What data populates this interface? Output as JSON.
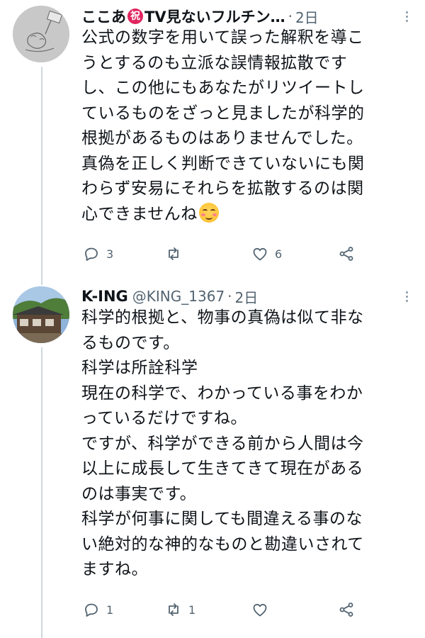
{
  "tweets": [
    {
      "display_name": "ここあ",
      "badge": "祝",
      "display_name_rest": "TV見ないフルチン…",
      "dot": "·",
      "time": "2日",
      "lines": [
        "公式の数字を用いて誤った解釈を導こ",
        "うとするのも立派な誤情報拡散です",
        "し、この他にもあなたがリツイートし",
        "ているものをざっと見ましたが科学的",
        "根拠があるものはありませんでした。",
        "真偽を正しく判断できていないにも関",
        "わらず安易にそれらを拡散するのは関",
        "心できませんね"
      ],
      "emoji": "smiling-face-icon",
      "replies": "3",
      "retweets": "",
      "likes": "6"
    },
    {
      "display_name": "K-ING",
      "handle": "@KING_1367",
      "dot": "·",
      "time": "2日",
      "lines": [
        "科学的根拠と、物事の真偽は似て非な",
        "るものです。",
        "科学は所詮科学",
        "現在の科学で、わかっている事をわか",
        "っているだけですね。",
        "ですが、科学ができる前から人間は今",
        "以上に成長して生きてきて現在がある",
        "のは事実です。",
        "科学が何事に関しても間違える事のな",
        "い絶対的な神的なものと勘違いされて",
        "ますね。"
      ],
      "replies": "1",
      "retweets": "1",
      "likes": ""
    }
  ],
  "colors": {
    "text": "#0f1419",
    "muted": "#536471",
    "thread_line": "#cfd9de",
    "badge": "#e0245e"
  }
}
